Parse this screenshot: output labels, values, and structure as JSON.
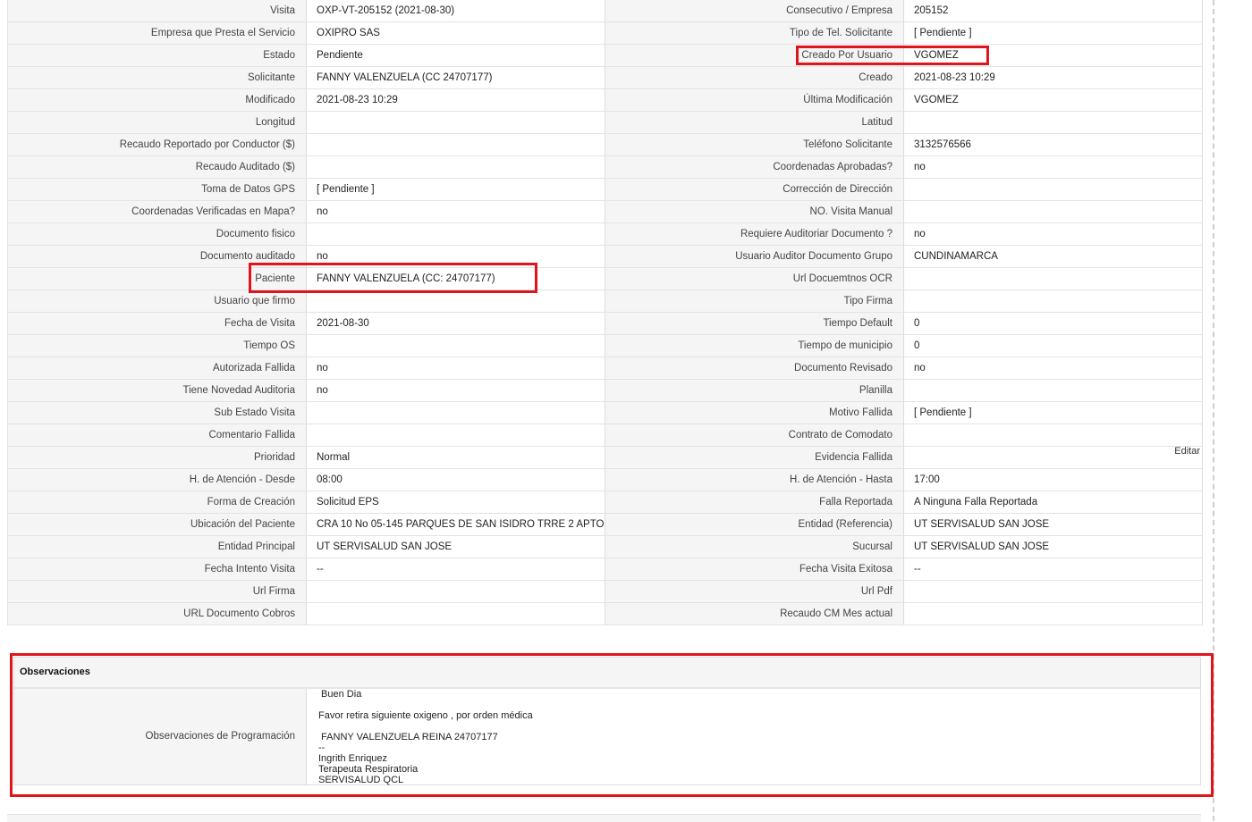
{
  "rows": [
    {
      "l1": "Visita",
      "v1": "OXP-VT-205152 (2021-08-30)",
      "l2": "Consecutivo / Empresa",
      "v2": "205152"
    },
    {
      "l1": "Empresa que Presta el Servicio",
      "v1": "OXIPRO SAS",
      "l2": "Tipo de Tel. Solicitante",
      "v2": "[ Pendiente ]"
    },
    {
      "l1": "Estado",
      "v1": "Pendiente",
      "l2": "Creado Por Usuario",
      "v2": "VGOMEZ"
    },
    {
      "l1": "Solicitante",
      "v1": "FANNY VALENZUELA (CC 24707177)",
      "l2": "Creado",
      "v2": "2021-08-23 10:29"
    },
    {
      "l1": "Modificado",
      "v1": "2021-08-23 10:29",
      "l2": "Última Modificación",
      "v2": " VGOMEZ"
    },
    {
      "l1": "Longitud",
      "v1": "",
      "l2": "Latitud",
      "v2": ""
    },
    {
      "l1": "Recaudo Reportado por Conductor ($)",
      "v1": "",
      "l2": "Teléfono Solicitante",
      "v2": "3132576566"
    },
    {
      "l1": "Recaudo Auditado ($)",
      "v1": "",
      "l2": "Coordenadas Aprobadas?",
      "v2": " no"
    },
    {
      "l1": "Toma de Datos GPS",
      "v1": "[ Pendiente ]",
      "l2": "Corrección de Dirección",
      "v2": ""
    },
    {
      "l1": "Coordenadas Verificadas en Mapa?",
      "v1": " no",
      "l2": "NO. Visita Manual",
      "v2": ""
    },
    {
      "l1": "Documento fisico",
      "v1": "",
      "l2": "Requiere Auditoriar Documento ?",
      "v2": " no"
    },
    {
      "l1": "Documento auditado",
      "v1": " no",
      "l2": "Usuario Auditor Documento Grupo",
      "v2": "CUNDINAMARCA"
    },
    {
      "l1": "Paciente",
      "v1": "FANNY VALENZUELA (CC: 24707177)",
      "l2": "Url Docuemtnos OCR",
      "v2": ""
    },
    {
      "l1": "Usuario que firmo",
      "v1": "",
      "l2": "Tipo Firma",
      "v2": ""
    },
    {
      "l1": "Fecha de Visita",
      "v1": " 2021-08-30",
      "l2": "Tiempo Default",
      "v2": "0"
    },
    {
      "l1": "Tiempo OS",
      "v1": "",
      "l2": "Tiempo de municipio",
      "v2": "0"
    },
    {
      "l1": "Autorizada Fallida",
      "v1": " no",
      "l2": "Documento Revisado",
      "v2": " no"
    },
    {
      "l1": "Tiene Novedad Auditoria",
      "v1": " no",
      "l2": "Planilla",
      "v2": ""
    },
    {
      "l1": "Sub Estado Visita",
      "v1": "",
      "l2": "Motivo Fallida",
      "v2": "[ Pendiente ]"
    },
    {
      "l1": "Comentario Fallida",
      "v1": "",
      "l2": "Contrato de Comodato",
      "v2": ""
    },
    {
      "l1": "Prioridad",
      "v1": "Normal",
      "l2": "Evidencia Fallida",
      "v2": ""
    },
    {
      "l1": "H. de Atención - Desde",
      "v1": "08:00",
      "l2": "H. de Atención - Hasta",
      "v2": "17:00"
    },
    {
      "l1": "Forma de Creación",
      "v1": "Solicitud EPS",
      "l2": "Falla Reportada",
      "v2": "A Ninguna Falla Reportada"
    },
    {
      "l1": "Ubicación del Paciente",
      "v1": "CRA 10 No 05-145 PARQUES DE SAN ISIDRO TRRE 2 APTO",
      "l2": "Entidad (Referencia)",
      "v2": "UT SERVISALUD SAN JOSE"
    },
    {
      "l1": "Entidad Principal",
      "v1": "UT SERVISALUD SAN JOSE",
      "l2": "Sucursal",
      "v2": "UT SERVISALUD SAN JOSE"
    },
    {
      "l1": "Fecha Intento Visita",
      "v1": " --",
      "l2": "Fecha Visita Exitosa",
      "v2": " --"
    },
    {
      "l1": "Url Firma",
      "v1": "",
      "l2": "Url Pdf",
      "v2": ""
    },
    {
      "l1": "URL Documento Cobros",
      "v1": "",
      "l2": "Recaudo CM Mes actual",
      "v2": ""
    }
  ],
  "edit_label": "Editar",
  "observaciones": {
    "title": "Observaciones",
    "label": "Observaciones de Programación",
    "lines": [
      " Buen Dia",
      "",
      "Favor retira siguiente oxigeno , por orden médica",
      "",
      " FANNY VALENZUELA REINA 24707177",
      "--",
      "Ingrith Enriquez",
      "Terapeuta Respiratoria",
      "SERVISALUD QCL"
    ]
  },
  "colors": {
    "highlight": "#e0141c",
    "label_bg": "#f5f5f5",
    "border": "#dcdcdc"
  }
}
